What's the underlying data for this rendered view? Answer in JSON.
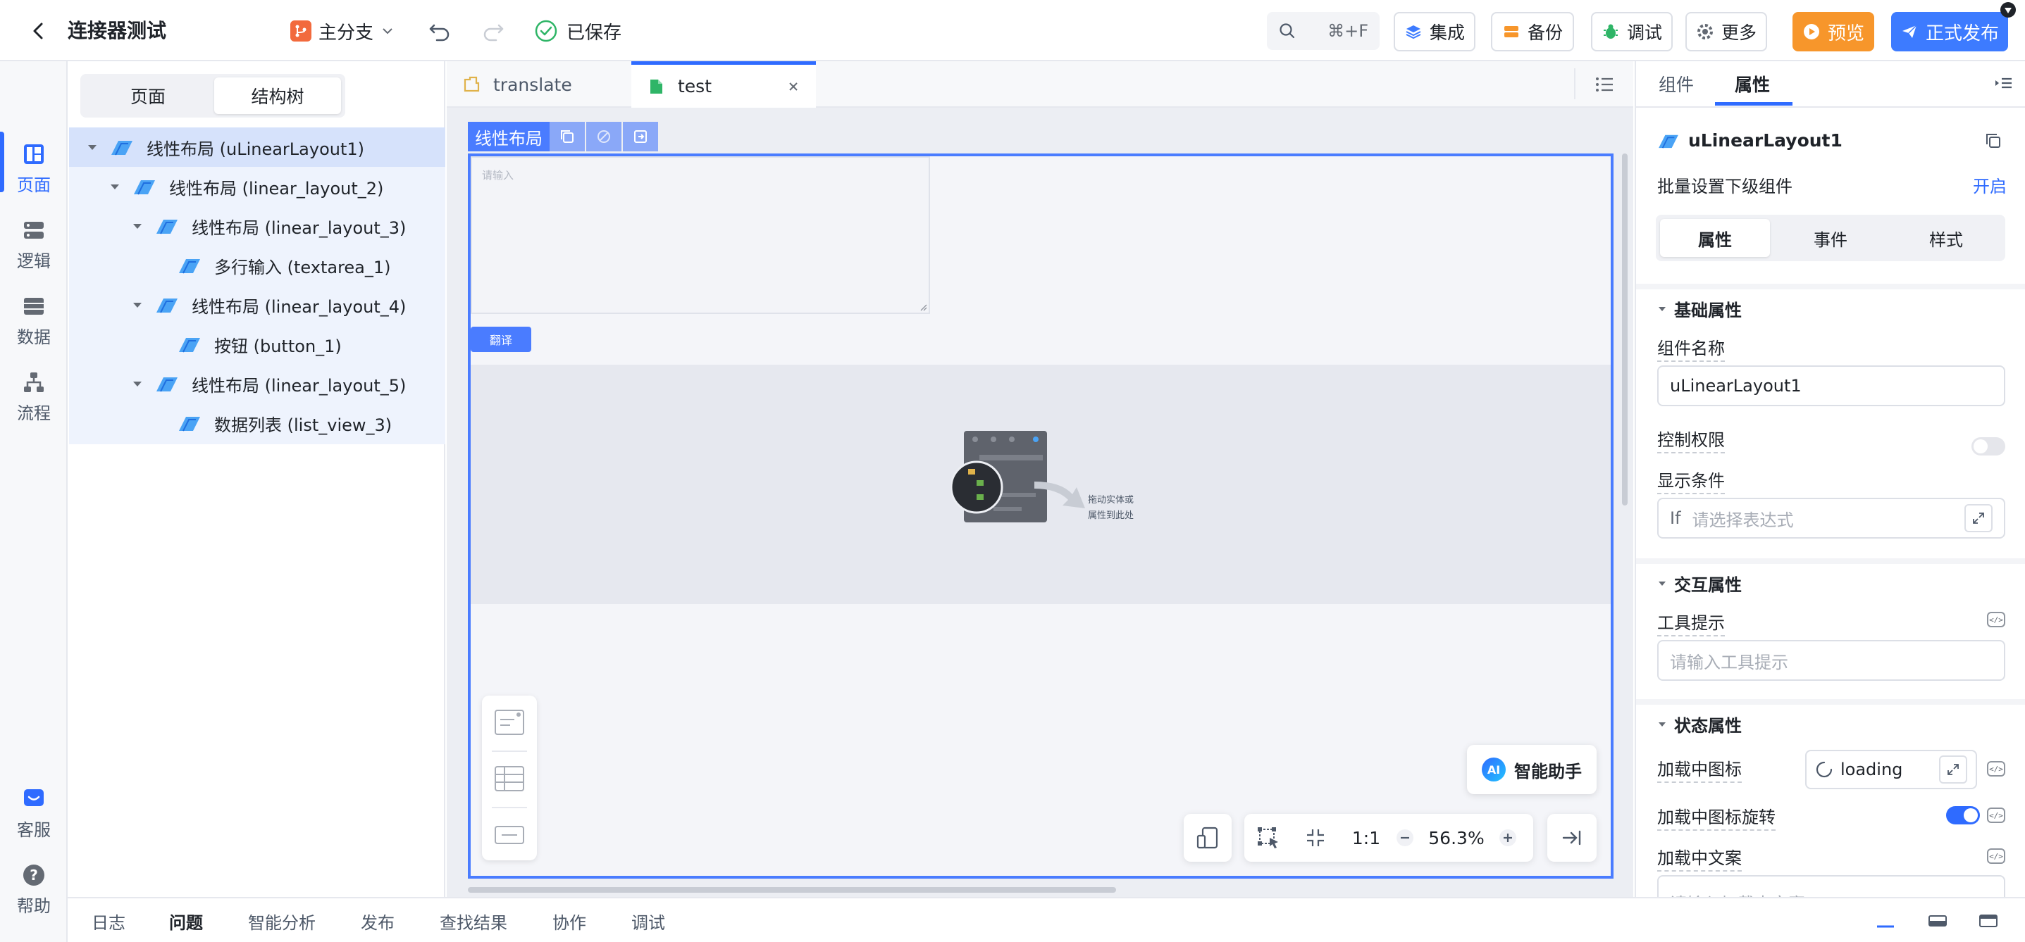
{
  "header": {
    "app_title": "连接器测试",
    "branch_label": "主分支",
    "saved_label": "已保存",
    "search_shortcut": "⌘+F",
    "integrate_label": "集成",
    "backup_label": "备份",
    "debug_label": "调试",
    "more_label": "更多",
    "preview_label": "预览",
    "publish_label": "正式发布"
  },
  "rail": {
    "items": [
      {
        "label": "页面",
        "icon": "page-icon"
      },
      {
        "label": "逻辑",
        "icon": "logic-icon"
      },
      {
        "label": "数据",
        "icon": "data-icon"
      },
      {
        "label": "流程",
        "icon": "flow-icon"
      }
    ],
    "bottom": [
      {
        "label": "客服",
        "icon": "support-icon"
      },
      {
        "label": "帮助",
        "icon": "help-icon"
      }
    ]
  },
  "structure": {
    "tabs": [
      "页面",
      "结构树"
    ],
    "active_tab": "结构树",
    "tree": [
      {
        "label": "线性布局 (uLinearLayout1)",
        "depth": 0,
        "expanded": true,
        "selected": true
      },
      {
        "label": "线性布局 (linear_layout_2)",
        "depth": 1,
        "expanded": true
      },
      {
        "label": "线性布局 (linear_layout_3)",
        "depth": 2,
        "expanded": true
      },
      {
        "label": "多行输入 (textarea_1)",
        "depth": 3
      },
      {
        "label": "线性布局 (linear_layout_4)",
        "depth": 2,
        "expanded": true
      },
      {
        "label": "按钮 (button_1)",
        "depth": 3
      },
      {
        "label": "线性布局 (linear_layout_5)",
        "depth": 2,
        "expanded": true
      },
      {
        "label": "数据列表 (list_view_3)",
        "depth": 3
      }
    ]
  },
  "editor": {
    "tabs": [
      {
        "label": "translate",
        "active": false
      },
      {
        "label": "test",
        "active": true
      }
    ],
    "selection_label": "线性布局",
    "textarea_placeholder": "请输入",
    "translate_button": "翻译",
    "drop_hint_line1": "拖动实体或",
    "drop_hint_line2": "属性到此处",
    "ai_label": "智能助手",
    "ai_badge": "AI",
    "zoom_ratio": "1:1",
    "zoom_level": "56.3%"
  },
  "properties": {
    "tabs": [
      "组件",
      "属性"
    ],
    "active_tab": "属性",
    "component_name": "uLinearLayout1",
    "batch_label": "批量设置下级组件",
    "batch_action": "开启",
    "sub_tabs": [
      "属性",
      "事件",
      "样式"
    ],
    "active_sub_tab": "属性",
    "section_basic": "基础属性",
    "name_label": "组件名称",
    "name_value": "uLinearLayout1",
    "permission_label": "控制权限",
    "permission_on": false,
    "condition_label": "显示条件",
    "condition_prefix": "If",
    "condition_placeholder": "请选择表达式",
    "section_interact": "交互属性",
    "tooltip_label": "工具提示",
    "tooltip_placeholder": "请输入工具提示",
    "section_state": "状态属性",
    "loading_icon_label": "加载中图标",
    "loading_icon_value": "loading",
    "loading_rotate_label": "加载中图标旋转",
    "loading_rotate_on": true,
    "loading_text_label": "加载中文案",
    "loading_text_placeholder": "请输入加载中文案"
  },
  "bottom_tabs": [
    "日志",
    "问题",
    "智能分析",
    "发布",
    "查找结果",
    "协作",
    "调试"
  ],
  "bottom_active": "问题",
  "colors": {
    "accent": "#2f6bff",
    "preview": "#f7962b",
    "publish": "#3d7bff",
    "tree_selected": "#d6e2fb",
    "selection_frame": "#4a7cff"
  }
}
